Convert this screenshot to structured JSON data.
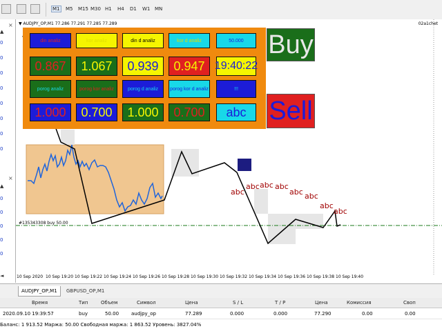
{
  "toolbar": {
    "timeframes": [
      "M1",
      "M5",
      "M15",
      "M30",
      "H1",
      "H4",
      "D1",
      "W1",
      "MN"
    ],
    "active_timeframe": "M1"
  },
  "left_panel": {
    "values": [
      "0",
      "0",
      "0",
      "0",
      "0",
      "0",
      "0",
      "0",
      "0",
      "0",
      "0",
      "0",
      "0"
    ]
  },
  "chart": {
    "title": "▼ AUDJPY_OP,M1  77.286 77.291 77.285 77.289",
    "name": "02a1chet",
    "order_label": "#135343308 buy 50.00",
    "x_ticks": [
      "10 Sep 2020",
      "10 Sep 19:20",
      "10 Sep 19:22",
      "10 Sep 19:24",
      "10 Sep 19:26",
      "10 Sep 19:28",
      "10 Sep 19:30",
      "10 Sep 19:32",
      "10 Sep 19:34",
      "10 Sep 19:36",
      "10 Sep 19:38",
      "10 Sep 19:40"
    ],
    "abc_labels": [
      "abc",
      "abc",
      "abc",
      "abc",
      "abc",
      "abc",
      "abc",
      "abc"
    ],
    "colors": {
      "order_line": "#1a7a1a",
      "zigzag": "#000000",
      "candles": "#1e64dc",
      "abc": "#a00000"
    }
  },
  "panel": {
    "labels": [
      {
        "text": "din analiz",
        "bg": "#1c1cd8",
        "fg": "#e02020"
      },
      {
        "text": "kor analiz",
        "bg": "#f5f500",
        "fg": "#e0e000"
      },
      {
        "text": "din d analiz",
        "bg": "#f5f500",
        "fg": "#000000"
      },
      {
        "text": "kor d analiz",
        "bg": "#18d8e8",
        "fg": "#e0e000"
      },
      {
        "text": "50.000",
        "bg": "#18d8e8",
        "fg": "#1c1cd8"
      },
      {
        "text": "porog analiz",
        "bg": "#1a6e1a",
        "fg": "#18d8e8"
      },
      {
        "text": "porog kor analiz",
        "bg": "#1a6e1a",
        "fg": "#e02020"
      },
      {
        "text": "porog d analiz",
        "bg": "#1c1cd8",
        "fg": "#18d8e8"
      },
      {
        "text": "porog kor d analiz",
        "bg": "#18d8e8",
        "fg": "#1c1cd8"
      },
      {
        "text": "!!!",
        "bg": "#1c1cd8",
        "fg": "#18d8e8"
      }
    ],
    "values": [
      {
        "text": "0.867",
        "bg": "#1a6e1a",
        "fg": "#e02020"
      },
      {
        "text": "1.067",
        "bg": "#1a6e1a",
        "fg": "#f5f500"
      },
      {
        "text": "0.939",
        "bg": "#f5f500",
        "fg": "#1c1cd8"
      },
      {
        "text": "0.947",
        "bg": "#e02020",
        "fg": "#f5f500"
      },
      {
        "text": "19:40:22",
        "bg": "#f5f500",
        "fg": "#1c1cd8"
      },
      {
        "text": "1.000",
        "bg": "#1c1cd8",
        "fg": "#e02020"
      },
      {
        "text": "0.700",
        "bg": "#1c1cd8",
        "fg": "#f5f500"
      },
      {
        "text": "1.000",
        "bg": "#1a6e1a",
        "fg": "#f5f500"
      },
      {
        "text": "0.700",
        "bg": "#1a6e1a",
        "fg": "#e02020"
      },
      {
        "text": "abc",
        "bg": "#18d8e8",
        "fg": "#1c1cd8"
      }
    ],
    "buy_label": "Buy",
    "sell_label": "Sell"
  },
  "tabs": [
    {
      "label": "AUDJPY_OP,M1",
      "active": true
    },
    {
      "label": "GBPUSD_OP,M1",
      "active": false
    }
  ],
  "trades": {
    "headers": [
      "Время",
      "Тип",
      "Объем",
      "Символ",
      "Цена",
      "S / L",
      "T / P",
      "Цена",
      "Комиссия",
      "Своп"
    ],
    "row": [
      "2020.09.10 19:39:57",
      "buy",
      "50.00",
      "audjpy_op",
      "77.289",
      "0.000",
      "0.000",
      "77.290",
      "0.00",
      "0.00"
    ],
    "summary": "Баланс: 1 913.52  Маржа: 50.00  Свободная маржа: 1 863.52  Уровень: 3827.04%"
  }
}
